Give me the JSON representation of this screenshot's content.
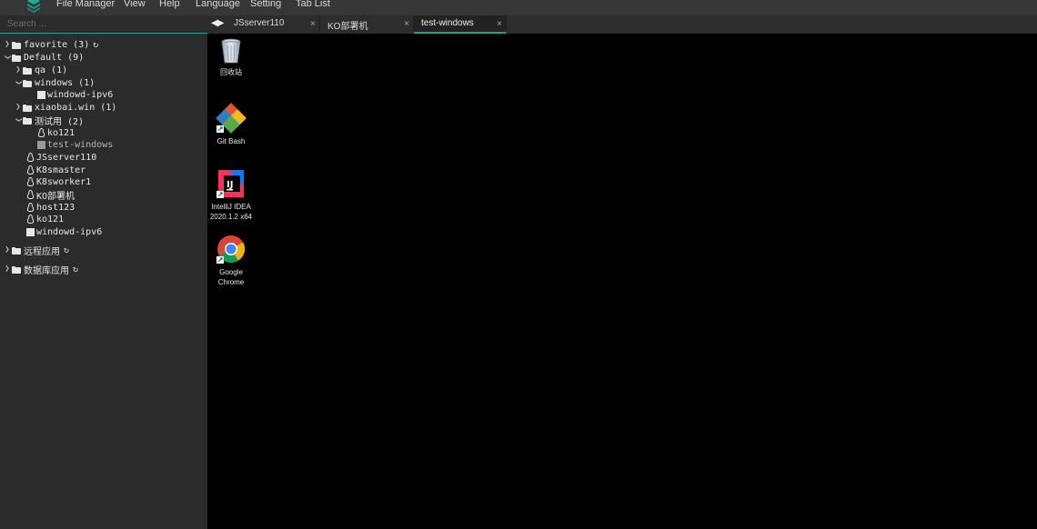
{
  "menubar": {
    "items": [
      "File Manager",
      "View",
      "Help",
      "Language",
      "Setting",
      "Tab List"
    ]
  },
  "search": {
    "placeholder": "Search ..."
  },
  "tree": {
    "favorite": "favorite (3)",
    "default": "Default (9)",
    "qa": "qa (1)",
    "windows": "windows (1)",
    "windowd_ipv6_child": "windowd-ipv6",
    "xiaobai": "xiaobai.win (1)",
    "test_group": "测试用 (2)",
    "ko121_child": "ko121",
    "test_windows": "test-windows",
    "jsserver110": "JSserver110",
    "k8smaster": "K8smaster",
    "k8sworker1": "K8sworker1",
    "ko_deploy": "KO部署机",
    "host123": "host123",
    "ko121": "ko121",
    "windowd_ipv6": "windowd-ipv6",
    "remote_apps": "远程应用",
    "db_apps": "数据库应用"
  },
  "tabs": [
    {
      "label": "JSserver110",
      "close": "×"
    },
    {
      "label": "KO部署机",
      "close": "×"
    },
    {
      "label": "test-windows",
      "close": "×"
    }
  ],
  "desktop": {
    "icons": [
      {
        "label": "回收站"
      },
      {
        "label": "Git Bash"
      },
      {
        "label_line1": "IntelliJ IDEA",
        "label_line2": "2020.1.2 x64"
      },
      {
        "label_line1": "Google",
        "label_line2": "Chrome"
      }
    ]
  },
  "colors": {
    "accent": "#18a58f",
    "sidebar_bg": "#2b2b2b",
    "menubar_bg": "#363636",
    "desktop_bg": "#000000"
  }
}
